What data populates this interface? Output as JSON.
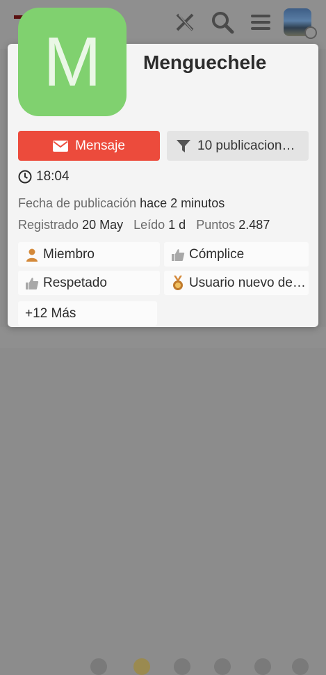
{
  "header": {
    "icons": [
      "x-logo-icon",
      "search-icon",
      "menu-icon",
      "user-avatar",
      "chat-badge-icon"
    ]
  },
  "profile": {
    "avatar_letter": "M",
    "avatar_color": "#80d16f",
    "username": "Menguechele"
  },
  "actions": {
    "message_label": "Mensaje",
    "posts_label": "10 publicacion…",
    "accent": "#ec4b3c"
  },
  "info": {
    "local_time": "18:04",
    "post_date_label": "Fecha de publicación",
    "post_date_value": "hace 2 minutos",
    "registered_label": "Registrado",
    "registered_value": "20 May",
    "read_label": "Leído",
    "read_value": "1 d",
    "points_label": "Puntos",
    "points_value": "2.487"
  },
  "badges": [
    {
      "label": "Miembro",
      "icon": "person-icon"
    },
    {
      "label": "Cómplice",
      "icon": "thumbs-up-icon"
    },
    {
      "label": "Respetado",
      "icon": "thumbs-up-icon"
    },
    {
      "label": "Usuario nuevo de…",
      "icon": "medal-icon"
    }
  ],
  "more_badges": "+12 Más"
}
